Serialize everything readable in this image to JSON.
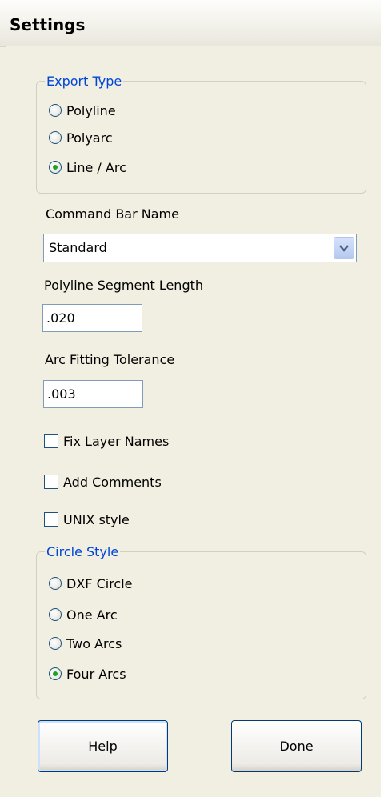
{
  "window": {
    "title": "Settings"
  },
  "export_type": {
    "legend": "Export Type",
    "options": [
      {
        "label": "Polyline",
        "selected": false
      },
      {
        "label": "Polyarc",
        "selected": false
      },
      {
        "label": "Line / Arc",
        "selected": true
      }
    ]
  },
  "command_bar": {
    "label": "Command Bar Name",
    "value": "Standard"
  },
  "polyline_segment": {
    "label": "Polyline Segment Length",
    "value": ".020"
  },
  "arc_tolerance": {
    "label": "Arc Fitting Tolerance",
    "value": ".003"
  },
  "checkboxes": [
    {
      "label": "Fix Layer Names",
      "checked": false
    },
    {
      "label": "Add Comments",
      "checked": false
    },
    {
      "label": "UNIX style",
      "checked": false
    }
  ],
  "circle_style": {
    "legend": "Circle Style",
    "options": [
      {
        "label": "DXF Circle",
        "selected": false
      },
      {
        "label": "One Arc",
        "selected": false
      },
      {
        "label": "Two Arcs",
        "selected": false
      },
      {
        "label": "Four Arcs",
        "selected": true
      }
    ]
  },
  "buttons": {
    "help": "Help",
    "done": "Done"
  },
  "icons": {
    "dropdown": "chevron-down-icon"
  },
  "colors": {
    "group_legend": "#0046d5",
    "radio_dot": "#21a121",
    "panel_bg": "#f1efe2"
  }
}
